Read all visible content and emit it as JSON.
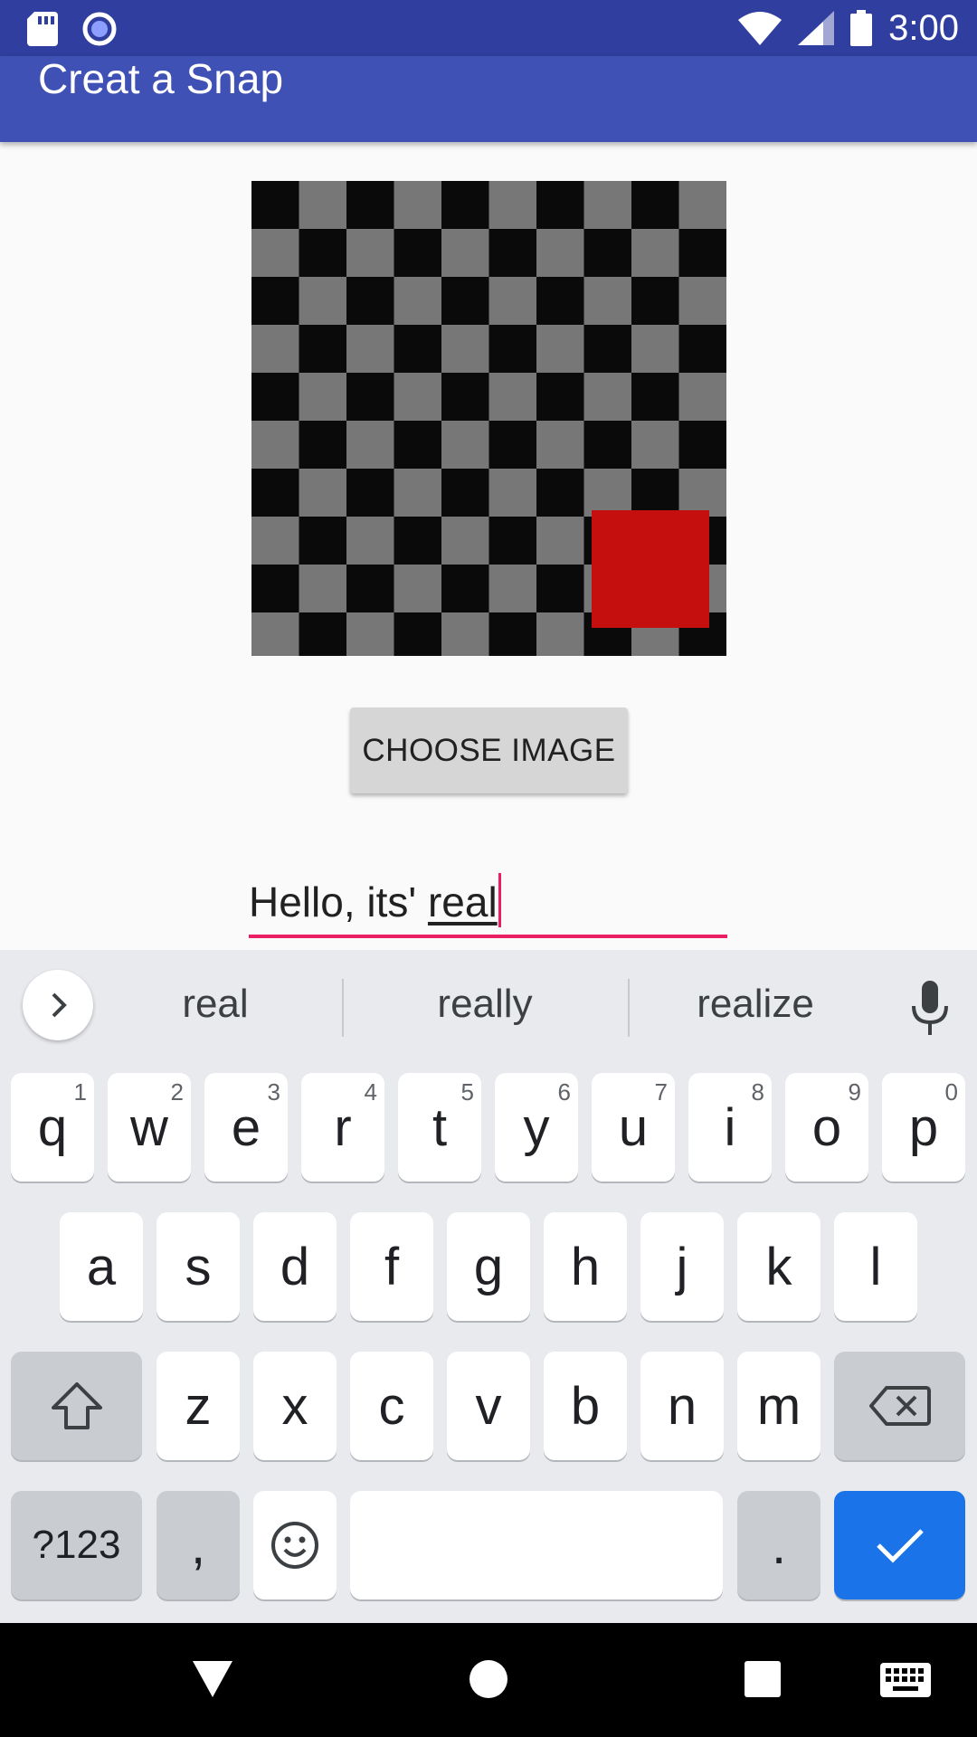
{
  "status_bar": {
    "time": "3:00",
    "left_icons": [
      "sd-card-icon",
      "sync-circle-icon"
    ],
    "right_icons": [
      "wifi-icon",
      "signal-icon",
      "battery-icon"
    ]
  },
  "app_bar": {
    "title": "Creat a Snap"
  },
  "colors": {
    "status_bar": "#303f9f",
    "app_bar": "#3f51b5",
    "accent": "#e91e63",
    "keyboard_action": "#1a73e8",
    "image_square": "#c50e0e"
  },
  "main": {
    "image_preview": {
      "description_icon": "checkerboard-image"
    },
    "choose_button": "CHOOSE IMAGE",
    "text_input": {
      "typed": "Hello, its' ",
      "composing": "real"
    }
  },
  "keyboard": {
    "suggestions": [
      "real",
      "really",
      "realize"
    ],
    "row1": [
      {
        "k": "q",
        "h": "1"
      },
      {
        "k": "w",
        "h": "2"
      },
      {
        "k": "e",
        "h": "3"
      },
      {
        "k": "r",
        "h": "4"
      },
      {
        "k": "t",
        "h": "5"
      },
      {
        "k": "y",
        "h": "6"
      },
      {
        "k": "u",
        "h": "7"
      },
      {
        "k": "i",
        "h": "8"
      },
      {
        "k": "o",
        "h": "9"
      },
      {
        "k": "p",
        "h": "0"
      }
    ],
    "row2": [
      "a",
      "s",
      "d",
      "f",
      "g",
      "h",
      "j",
      "k",
      "l"
    ],
    "row3": [
      "z",
      "x",
      "c",
      "v",
      "b",
      "n",
      "m"
    ],
    "symbols_key": "?123",
    "comma_key": ",",
    "period_key": "."
  },
  "nav_bar": {
    "icons": [
      "back-icon",
      "home-icon",
      "recents-icon",
      "keyboard-switch-icon"
    ]
  }
}
